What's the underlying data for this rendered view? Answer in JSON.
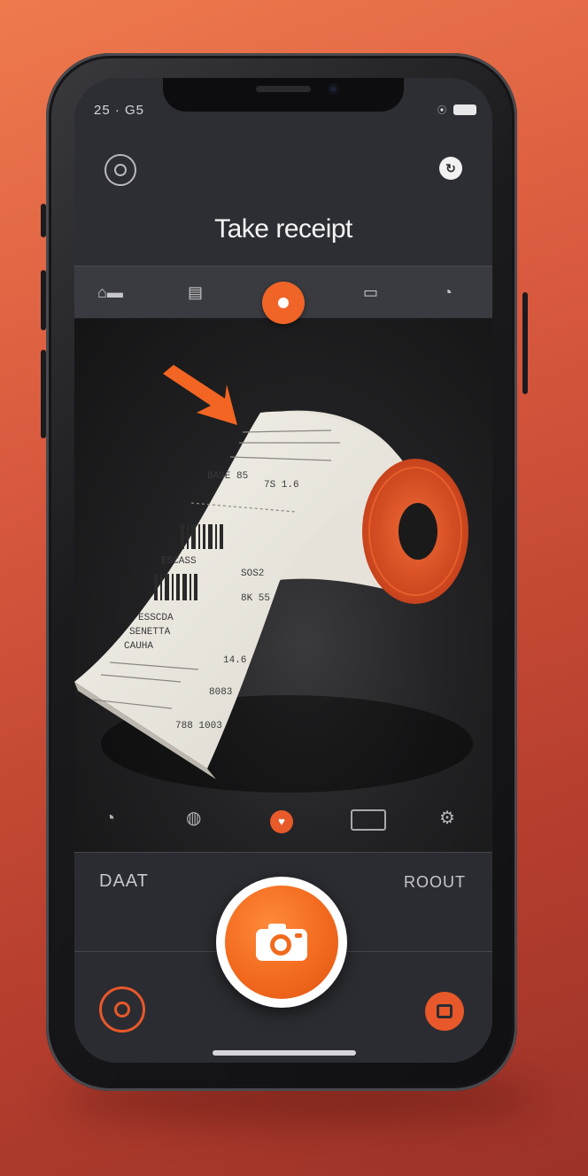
{
  "status_bar": {
    "time": "25 · G5",
    "signal_icon": "signal-icon",
    "battery_icon": "battery-icon"
  },
  "header": {
    "title": "Take receipt",
    "left_icon": "camera-target-icon",
    "right_icon": "refresh-icon"
  },
  "mode_bar": {
    "icons": [
      "home-icon",
      "document-icon",
      "capture-icon",
      "folder-icon",
      "chart-icon"
    ],
    "active_index": 2
  },
  "viewfinder": {
    "subject": "receipt-roll-image",
    "receipt_lines": [
      "ESCASS",
      "ESSCDA",
      "SENETTA",
      "CAUHA",
      "BASE 85",
      "7S 1.6",
      "SOS2",
      "8K 55",
      "14.6",
      "8083",
      "788 1003"
    ]
  },
  "camera_tools": {
    "icons": [
      "timer-icon",
      "flash-icon",
      "receipt-icon",
      "frame-icon",
      "settings-icon"
    ],
    "active_index": 2
  },
  "bottom": {
    "left_label": "DAAT",
    "right_label": "ROOUT",
    "shutter_icon": "camera-icon",
    "left_button_icon": "record-icon",
    "right_button_icon": "gallery-icon"
  },
  "colors": {
    "accent": "#f06428",
    "screen_bg": "#2d2e33",
    "panel_bg": "#2b2c31"
  }
}
